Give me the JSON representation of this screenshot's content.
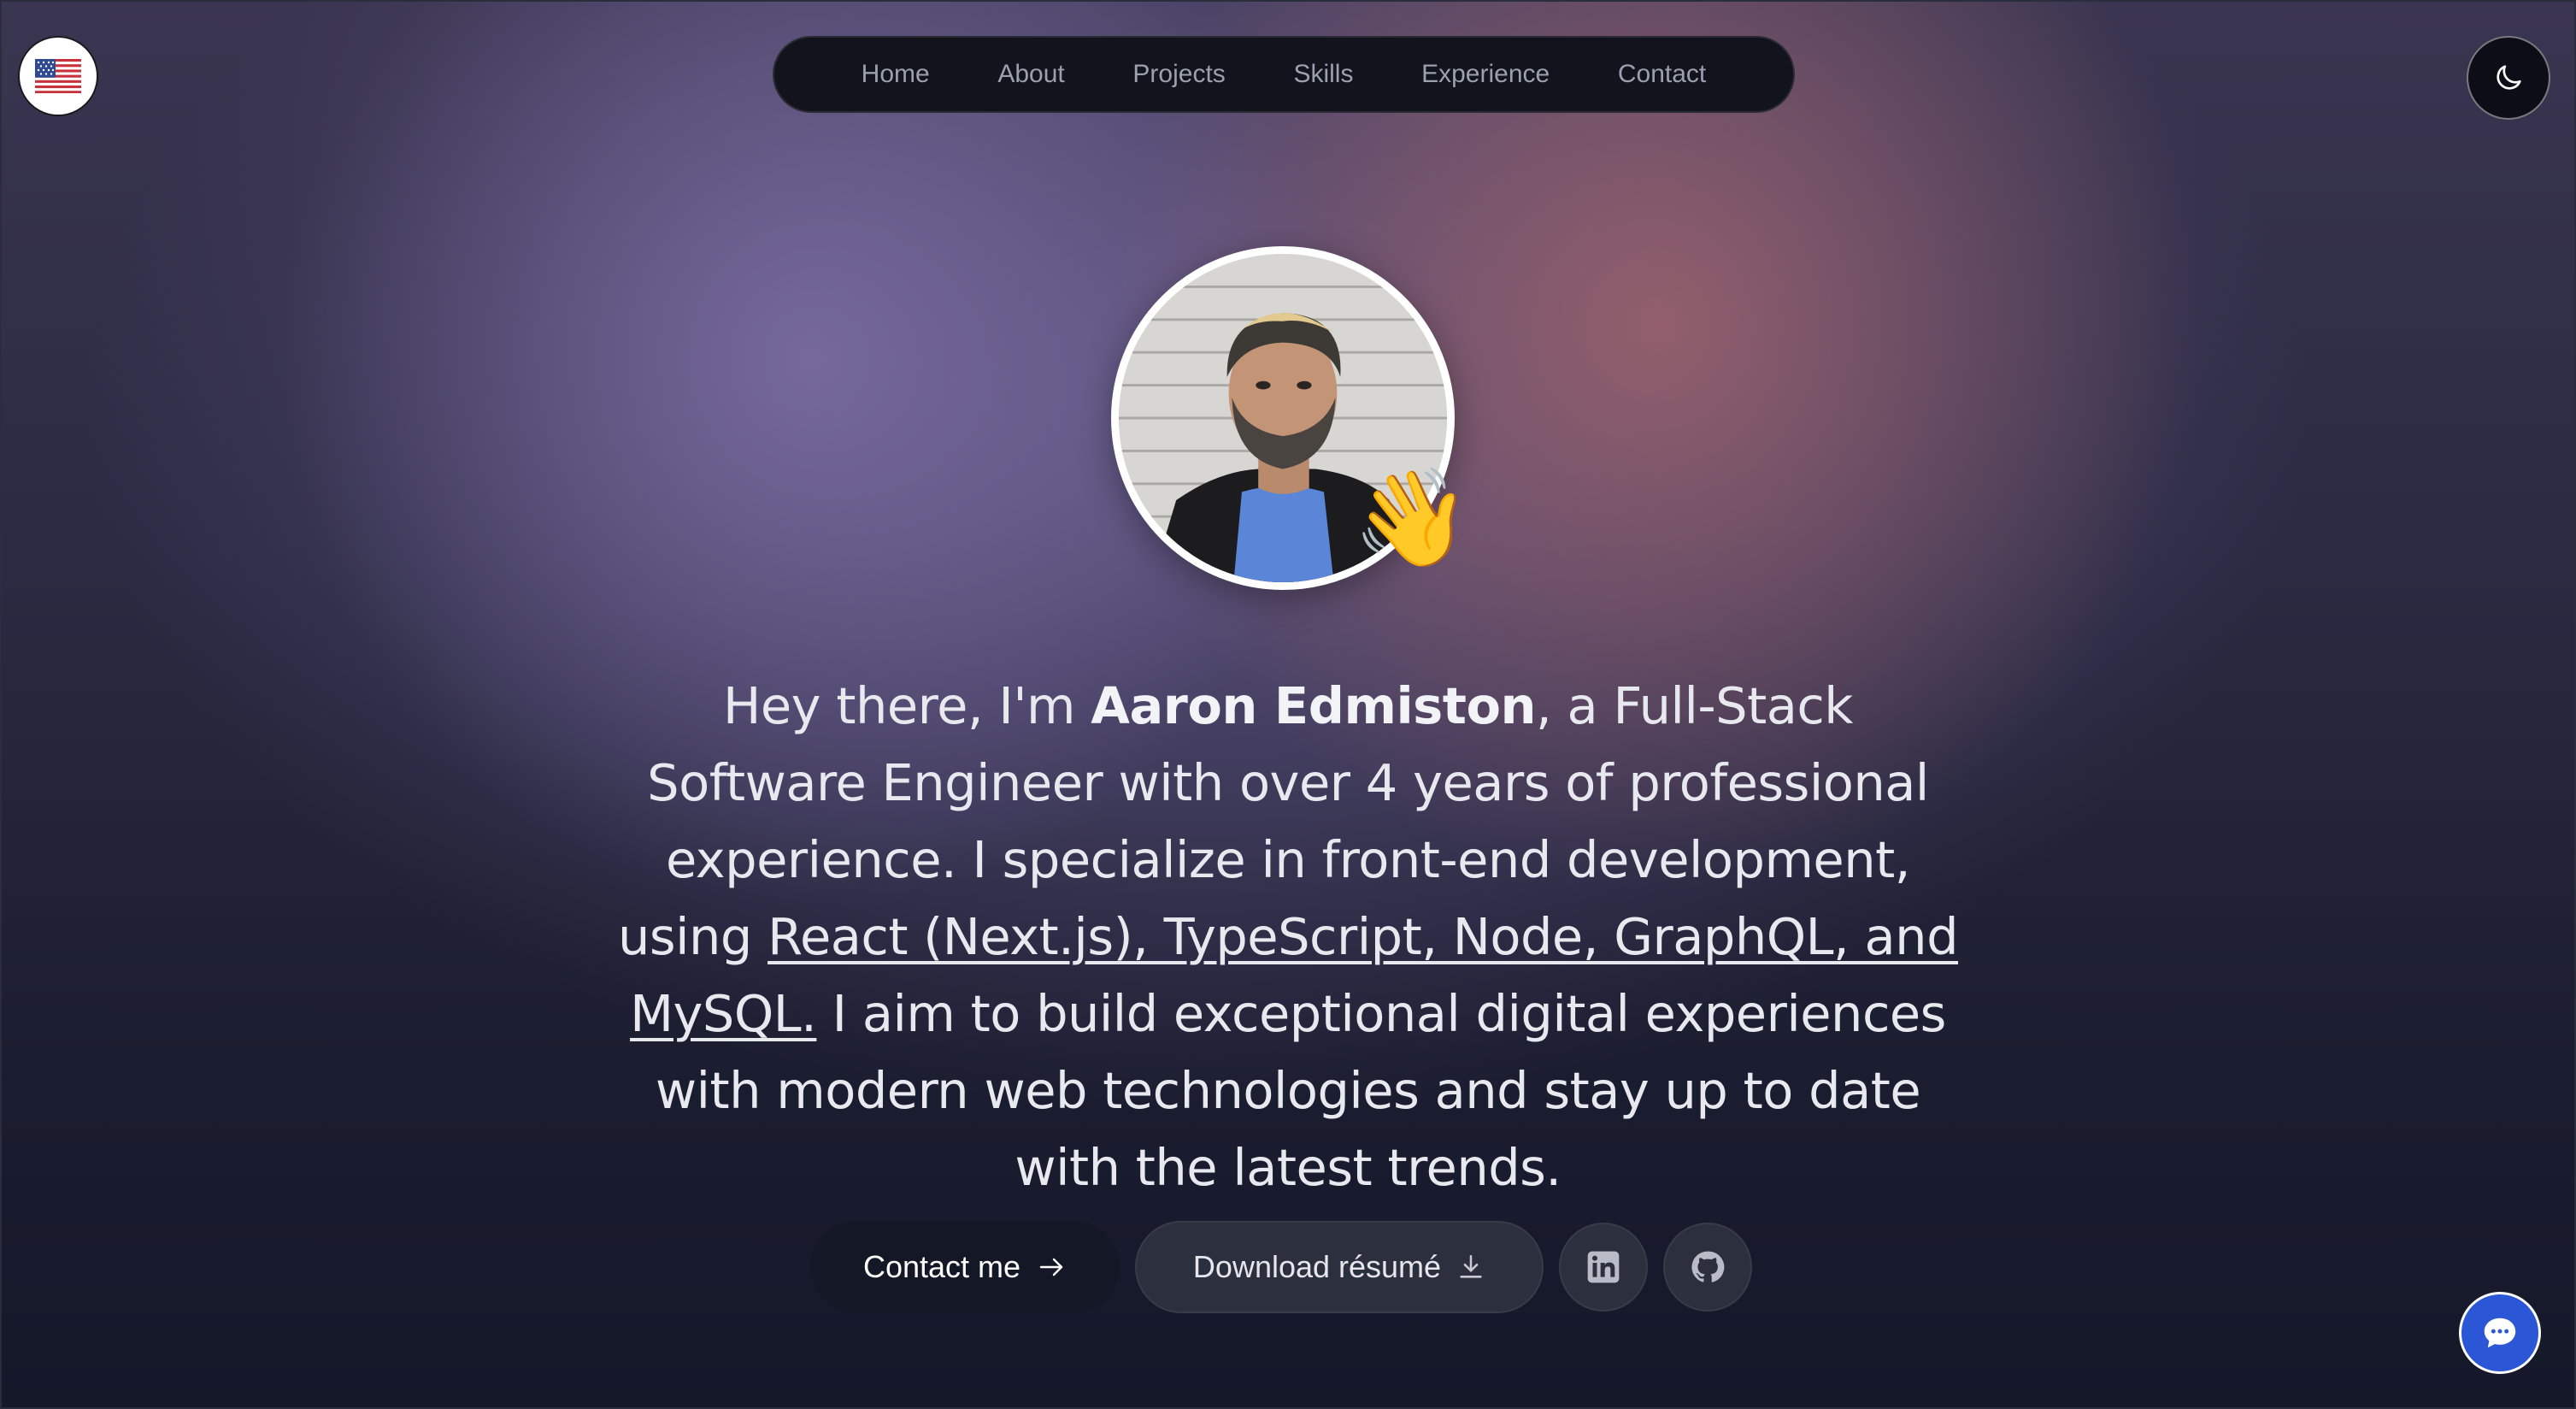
{
  "header": {
    "language_icon": "us-flag-icon",
    "theme_icon": "moon-icon"
  },
  "nav": {
    "items": [
      {
        "label": "Home"
      },
      {
        "label": "About"
      },
      {
        "label": "Projects"
      },
      {
        "label": "Skills"
      },
      {
        "label": "Experience"
      },
      {
        "label": "Contact"
      }
    ]
  },
  "hero": {
    "avatar_icon": "profile-photo",
    "wave_emoji": "👋",
    "intro_prefix": "Hey there, I'm ",
    "name": "Aaron Edmiston",
    "intro_middle": ", a Full-Stack Software Engineer with over 4 years of professional experience. I specialize in front-end development, using ",
    "stack": "React (Next.js), TypeScript, Node, GraphQL, and MySQL.",
    "intro_suffix": " I aim to build exceptional digital experiences with modern web technologies and stay up to date with the latest trends."
  },
  "actions": {
    "contact_label": "Contact me",
    "contact_icon": "arrow-right-icon",
    "resume_label": "Download résumé",
    "resume_icon": "download-icon",
    "linkedin_icon": "linkedin-icon",
    "github_icon": "github-icon"
  },
  "chat": {
    "icon": "chat-bubble-icon",
    "color": "#2b56d6"
  }
}
